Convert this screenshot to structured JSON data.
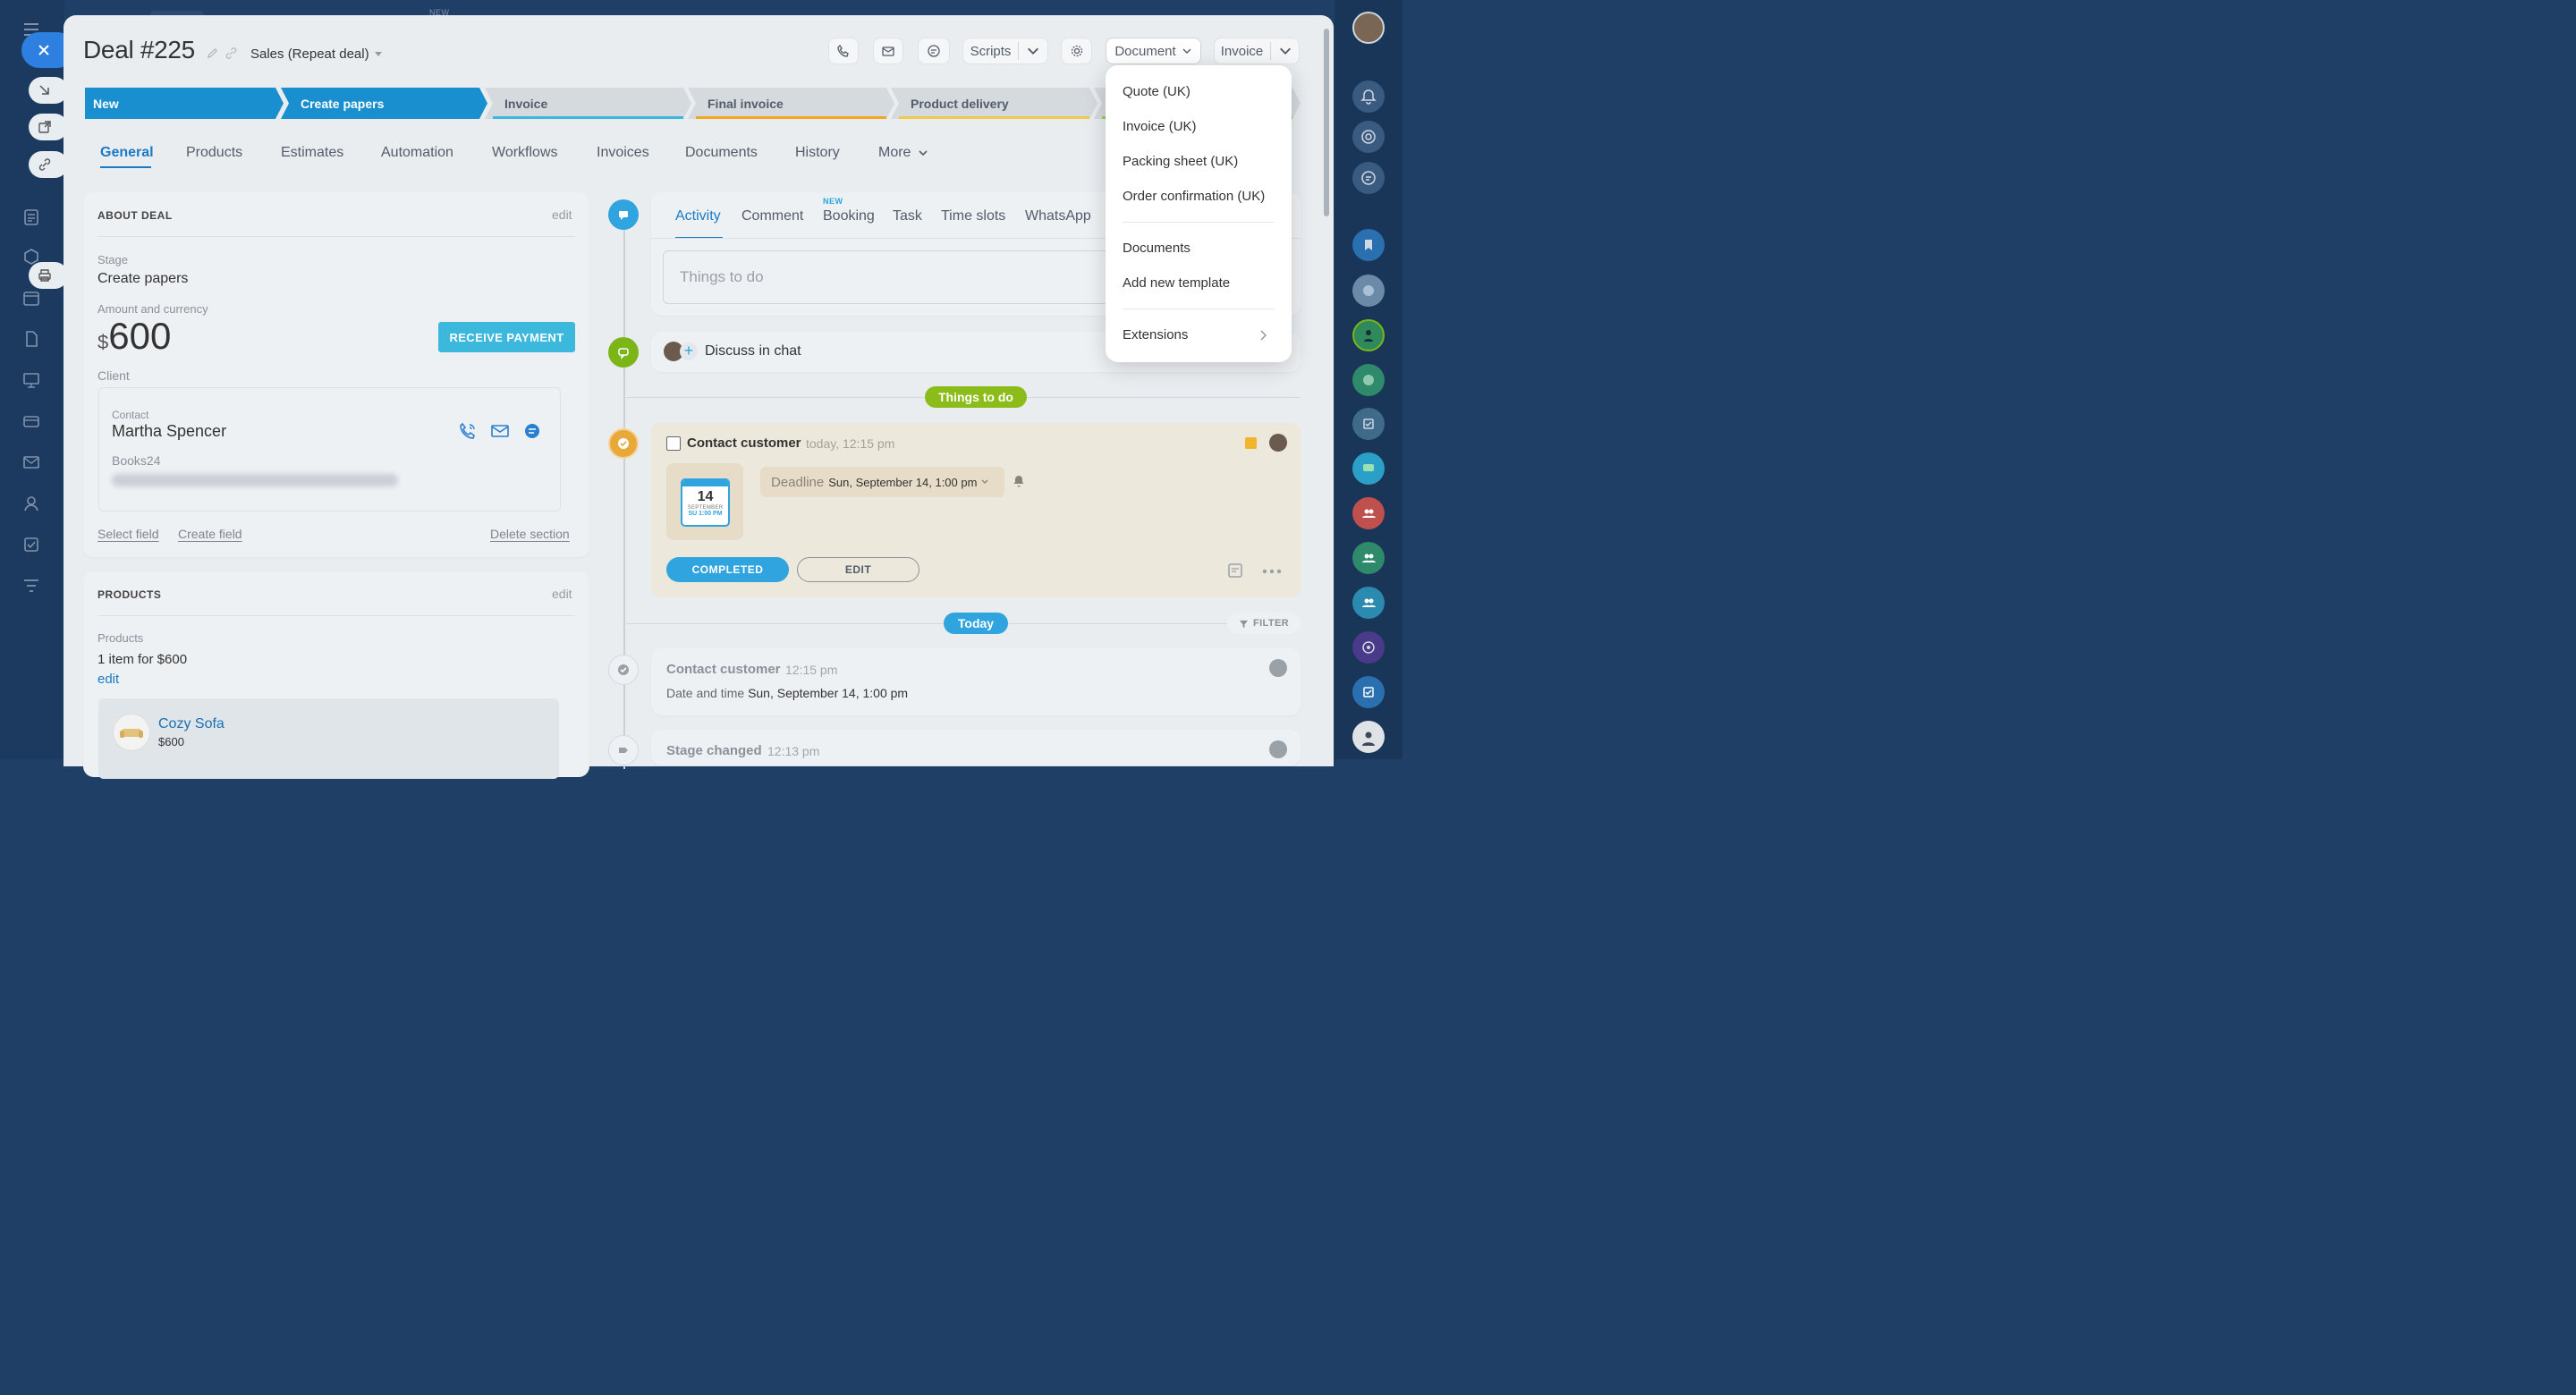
{
  "top_bar": {
    "new_tag": "NEW"
  },
  "header": {
    "title": "Deal #225",
    "pipeline": "Sales (Repeat deal)",
    "buttons": {
      "scripts": "Scripts",
      "document": "Document",
      "invoice": "Invoice"
    }
  },
  "stages": [
    {
      "label": "New",
      "state": "active"
    },
    {
      "label": "Create papers",
      "state": "active"
    },
    {
      "label": "Invoice",
      "state": "inactive",
      "color": "#3bb8db"
    },
    {
      "label": "Final invoice",
      "state": "inactive",
      "color": "#f2a623"
    },
    {
      "label": "Product delivery",
      "state": "inactive",
      "color": "#f2c94c"
    }
  ],
  "tabs": [
    "General",
    "Products",
    "Estimates",
    "Automation",
    "Workflows",
    "Invoices",
    "Documents",
    "History",
    "More"
  ],
  "about_deal": {
    "title": "ABOUT DEAL",
    "edit": "edit",
    "stage_label": "Stage",
    "stage_value": "Create papers",
    "amount_label": "Amount and currency",
    "currency_symbol": "$",
    "amount": "600",
    "receive_payment": "RECEIVE PAYMENT",
    "client_label": "Client",
    "contact_label": "Contact",
    "contact_name": "Martha Spencer",
    "company": "Books24",
    "select_field": "Select field",
    "create_field": "Create field",
    "delete_section": "Delete section"
  },
  "products": {
    "title": "PRODUCTS",
    "edit": "edit",
    "label": "Products",
    "summary": "1 item for $600",
    "edit_link": "edit",
    "item_name": "Cozy Sofa",
    "item_price": "$600"
  },
  "activity": {
    "tabs": [
      "Activity",
      "Comment",
      "Booking",
      "Task",
      "Time slots",
      "WhatsApp"
    ],
    "new_badge": "NEW",
    "placeholder": "Things to do",
    "discuss": "Discuss in chat",
    "things_to_do_pill": "Things to do",
    "task": {
      "title": "Contact customer",
      "time": "today, 12:15 pm",
      "calendar_day": "14",
      "calendar_month": "SEPTEMBER",
      "calendar_time": "SU 1:00 PM",
      "deadline_label": "Deadline",
      "deadline_value": "Sun, September 14, 1:00 pm",
      "completed": "COMPLETED",
      "edit": "EDIT"
    },
    "today_pill": "Today",
    "filter": "FILTER",
    "history": [
      {
        "title": "Contact customer",
        "time": "12:15 pm",
        "detail_label": "Date and time",
        "detail_value": "Sun, September 14, 1:00 pm"
      },
      {
        "title": "Stage changed",
        "time": "12:13 pm"
      }
    ]
  },
  "document_menu": {
    "items": [
      "Quote (UK)",
      "Invoice (UK)",
      "Packing sheet (UK)",
      "Order confirmation (UK)"
    ],
    "items2": [
      "Documents",
      "Add new template"
    ],
    "extensions": "Extensions"
  },
  "colors": {
    "accent": "#1a8fd0",
    "green": "#7cb518",
    "orange": "#f2a623"
  }
}
